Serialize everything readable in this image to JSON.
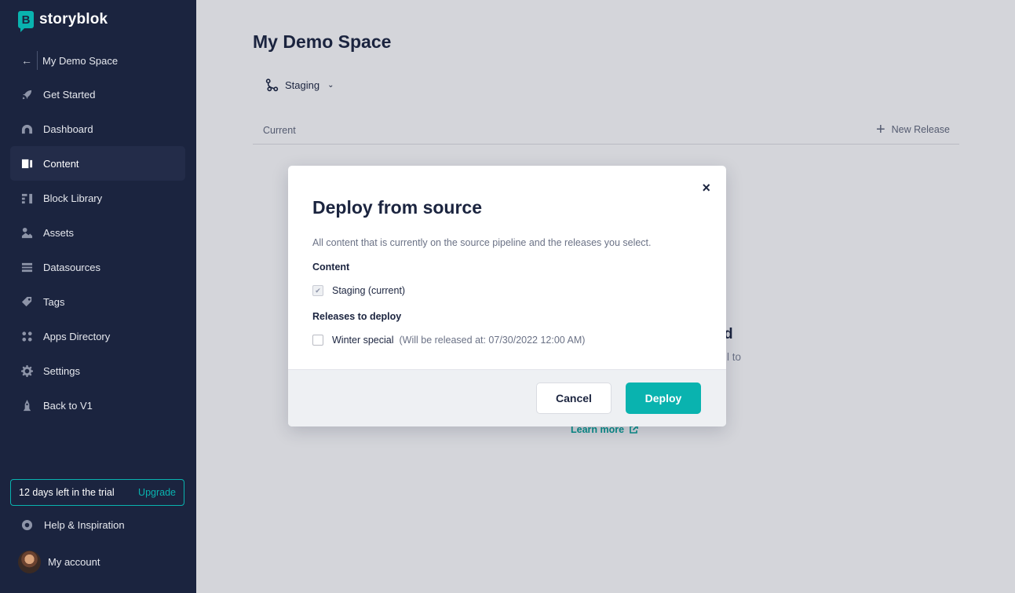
{
  "brand": {
    "name": "storyblok",
    "mark": "B",
    "color": "#09b3af"
  },
  "sidebar": {
    "space_name": "My Demo Space",
    "items": [
      {
        "label": "Get Started",
        "icon": "rocket-icon"
      },
      {
        "label": "Dashboard",
        "icon": "dashboard-icon"
      },
      {
        "label": "Content",
        "icon": "content-icon",
        "active": true
      },
      {
        "label": "Block Library",
        "icon": "blocks-icon"
      },
      {
        "label": "Assets",
        "icon": "assets-icon"
      },
      {
        "label": "Datasources",
        "icon": "datasources-icon"
      },
      {
        "label": "Tags",
        "icon": "tag-icon"
      },
      {
        "label": "Apps Directory",
        "icon": "apps-icon"
      },
      {
        "label": "Settings",
        "icon": "gear-icon"
      },
      {
        "label": "Back to V1",
        "icon": "back-v1-icon"
      }
    ],
    "trial_text": "12 days left in the trial",
    "upgrade_label": "Upgrade",
    "help_label": "Help & Inspiration",
    "account_label": "My account"
  },
  "main": {
    "title": "My Demo Space",
    "pipeline": "Staging",
    "tab_current": "Current",
    "new_release": "New Release",
    "bg_heading_partial": "d",
    "bg_sub_partial": "l to",
    "learn_more": "Learn more"
  },
  "modal": {
    "title": "Deploy from source",
    "description": "All content that is currently on the source pipeline and the releases you select.",
    "content_label": "Content",
    "content_option": "Staging (current)",
    "releases_label": "Releases to deploy",
    "release_name": "Winter special",
    "release_note": "(Will be released at: 07/30/2022 12:00 AM)",
    "close_label": "×",
    "cancel_label": "Cancel",
    "deploy_label": "Deploy"
  }
}
